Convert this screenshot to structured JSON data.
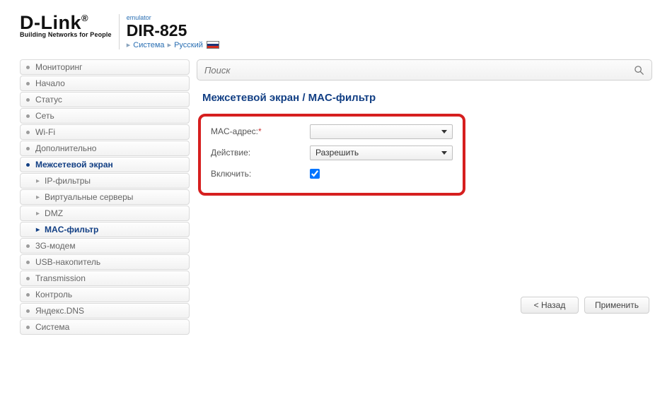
{
  "brand": {
    "name": "D-Link",
    "tagline": "Building Networks for People",
    "emulator": "emulator",
    "model": "DIR-825"
  },
  "breadcrumb": {
    "system": "Система",
    "language": "Русский"
  },
  "search": {
    "placeholder": "Поиск"
  },
  "sidebar": {
    "items": [
      {
        "label": "Мониторинг"
      },
      {
        "label": "Начало"
      },
      {
        "label": "Статус"
      },
      {
        "label": "Сеть"
      },
      {
        "label": "Wi-Fi"
      },
      {
        "label": "Дополнительно"
      },
      {
        "label": "Межсетевой экран",
        "expanded": true,
        "children": [
          {
            "label": "IP-фильтры"
          },
          {
            "label": "Виртуальные серверы"
          },
          {
            "label": "DMZ"
          },
          {
            "label": "MAC-фильтр",
            "active": true
          }
        ]
      },
      {
        "label": "3G-модем"
      },
      {
        "label": "USB-накопитель"
      },
      {
        "label": "Transmission"
      },
      {
        "label": "Контроль"
      },
      {
        "label": "Яндекс.DNS"
      },
      {
        "label": "Система"
      }
    ]
  },
  "page": {
    "title": "Межсетевой экран /  MAC-фильтр"
  },
  "form": {
    "mac_label": "MAC-адрес:",
    "mac_value": "",
    "action_label": "Действие:",
    "action_value": "Разрешить",
    "enable_label": "Включить:",
    "enable_checked": true
  },
  "buttons": {
    "back": "< Назад",
    "apply": "Применить"
  }
}
